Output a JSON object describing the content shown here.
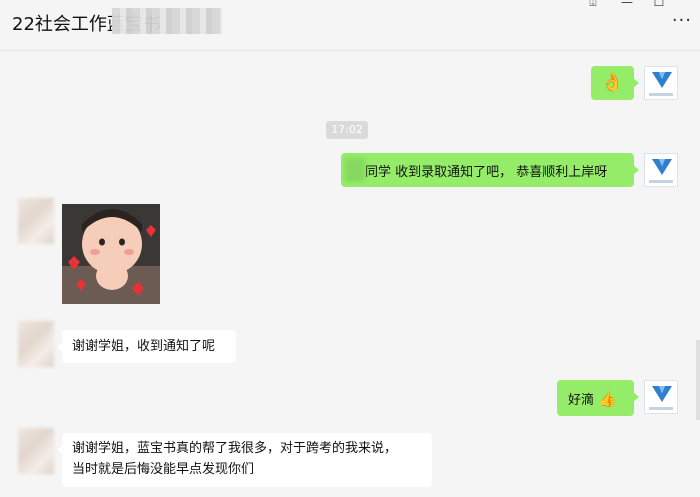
{
  "window": {
    "title": "22社会工作蓝宝书",
    "pin_glyph": "⍗",
    "minimize_glyph": "—",
    "maximize_glyph": "☐",
    "more_glyph": "···"
  },
  "messages": {
    "m1_emoji": "👌",
    "time_divider": "17:02",
    "m2_text": "同学 收到录取通知了吧， 恭喜顺利上岸呀",
    "m4_text": "谢谢学姐，收到通知了呢",
    "m5_text": "好滴",
    "m5_emoji": "👍",
    "m6_line1": "谢谢学姐，蓝宝书真的帮了我很多，对于跨考的我来说，",
    "m6_line2": "当时就是后悔没能早点发现你们"
  },
  "colors": {
    "sent_bubble": "#95ec69",
    "received_bubble": "#ffffff",
    "background": "#f5f5f5",
    "logo_blue": "#2f7fd0"
  },
  "icons": {
    "logo": "blue-v-logo-icon",
    "pin": "pin-icon",
    "minimize": "minimize-icon",
    "maximize": "maximize-icon",
    "more": "more-icon"
  }
}
